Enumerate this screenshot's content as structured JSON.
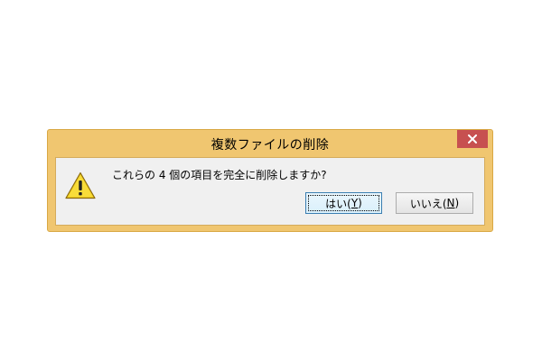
{
  "dialog": {
    "title": "複数ファイルの削除",
    "message": "これらの 4 個の項目を完全に削除しますか?",
    "icon": "warning-icon",
    "buttons": {
      "yes": {
        "prefix": "はい(",
        "accel": "Y",
        "suffix": ")"
      },
      "no": {
        "prefix": "いいえ(",
        "accel": "N",
        "suffix": ")"
      }
    },
    "colors": {
      "frame": "#f0c670",
      "close": "#c75050",
      "content_bg": "#f0f0f0"
    }
  }
}
